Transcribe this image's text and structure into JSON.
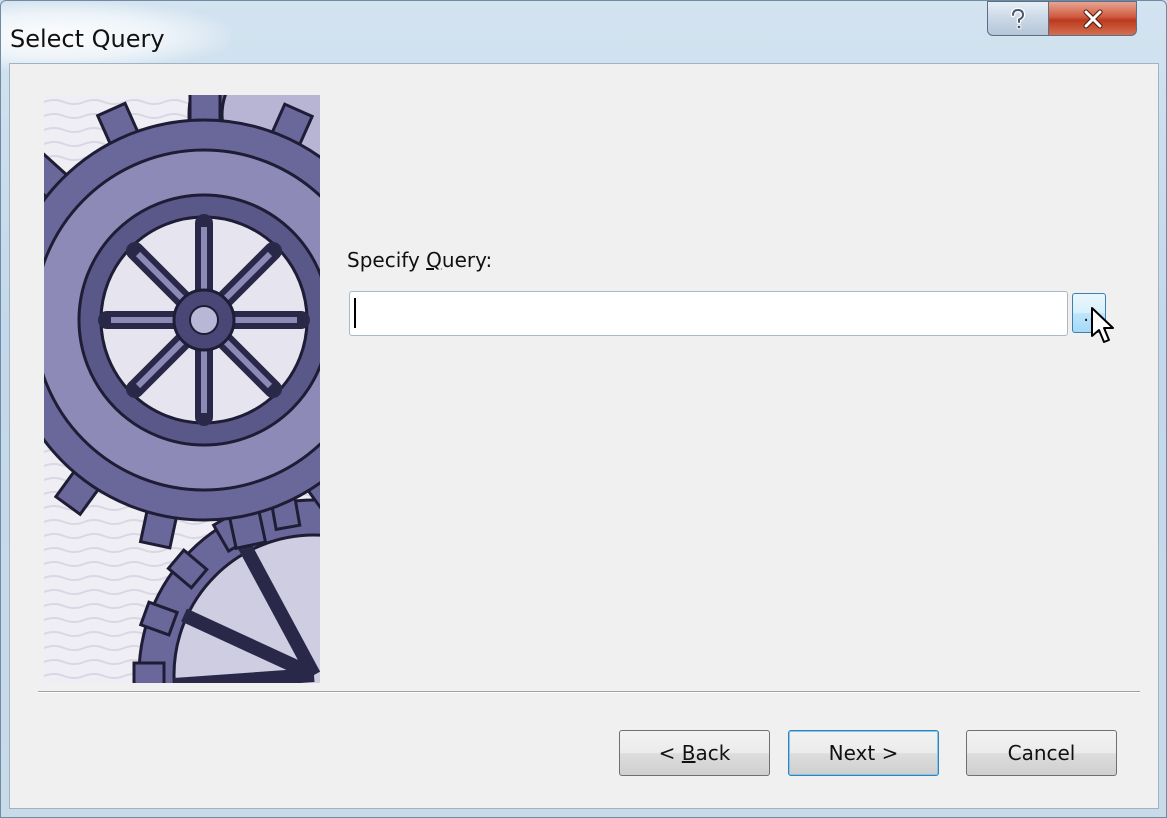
{
  "window": {
    "title": "Select Query"
  },
  "caption_buttons": {
    "help_icon": "question-mark-icon",
    "close_icon": "close-x-icon"
  },
  "form": {
    "label_prefix": "Specify ",
    "label_accel": "Q",
    "label_suffix": "uery:",
    "query_value": "",
    "browse_label": ".."
  },
  "footer": {
    "back_prefix": "< ",
    "back_accel": "B",
    "back_suffix": "ack",
    "next_label": "Next >",
    "cancel_label": "Cancel"
  },
  "icons": {
    "gear_art": "gears-illustration",
    "pointer": "mouse-pointer-icon"
  },
  "colors": {
    "accent": "#3c7fb1",
    "close_button": "#c9442a",
    "gear": "#5f5d8f"
  }
}
